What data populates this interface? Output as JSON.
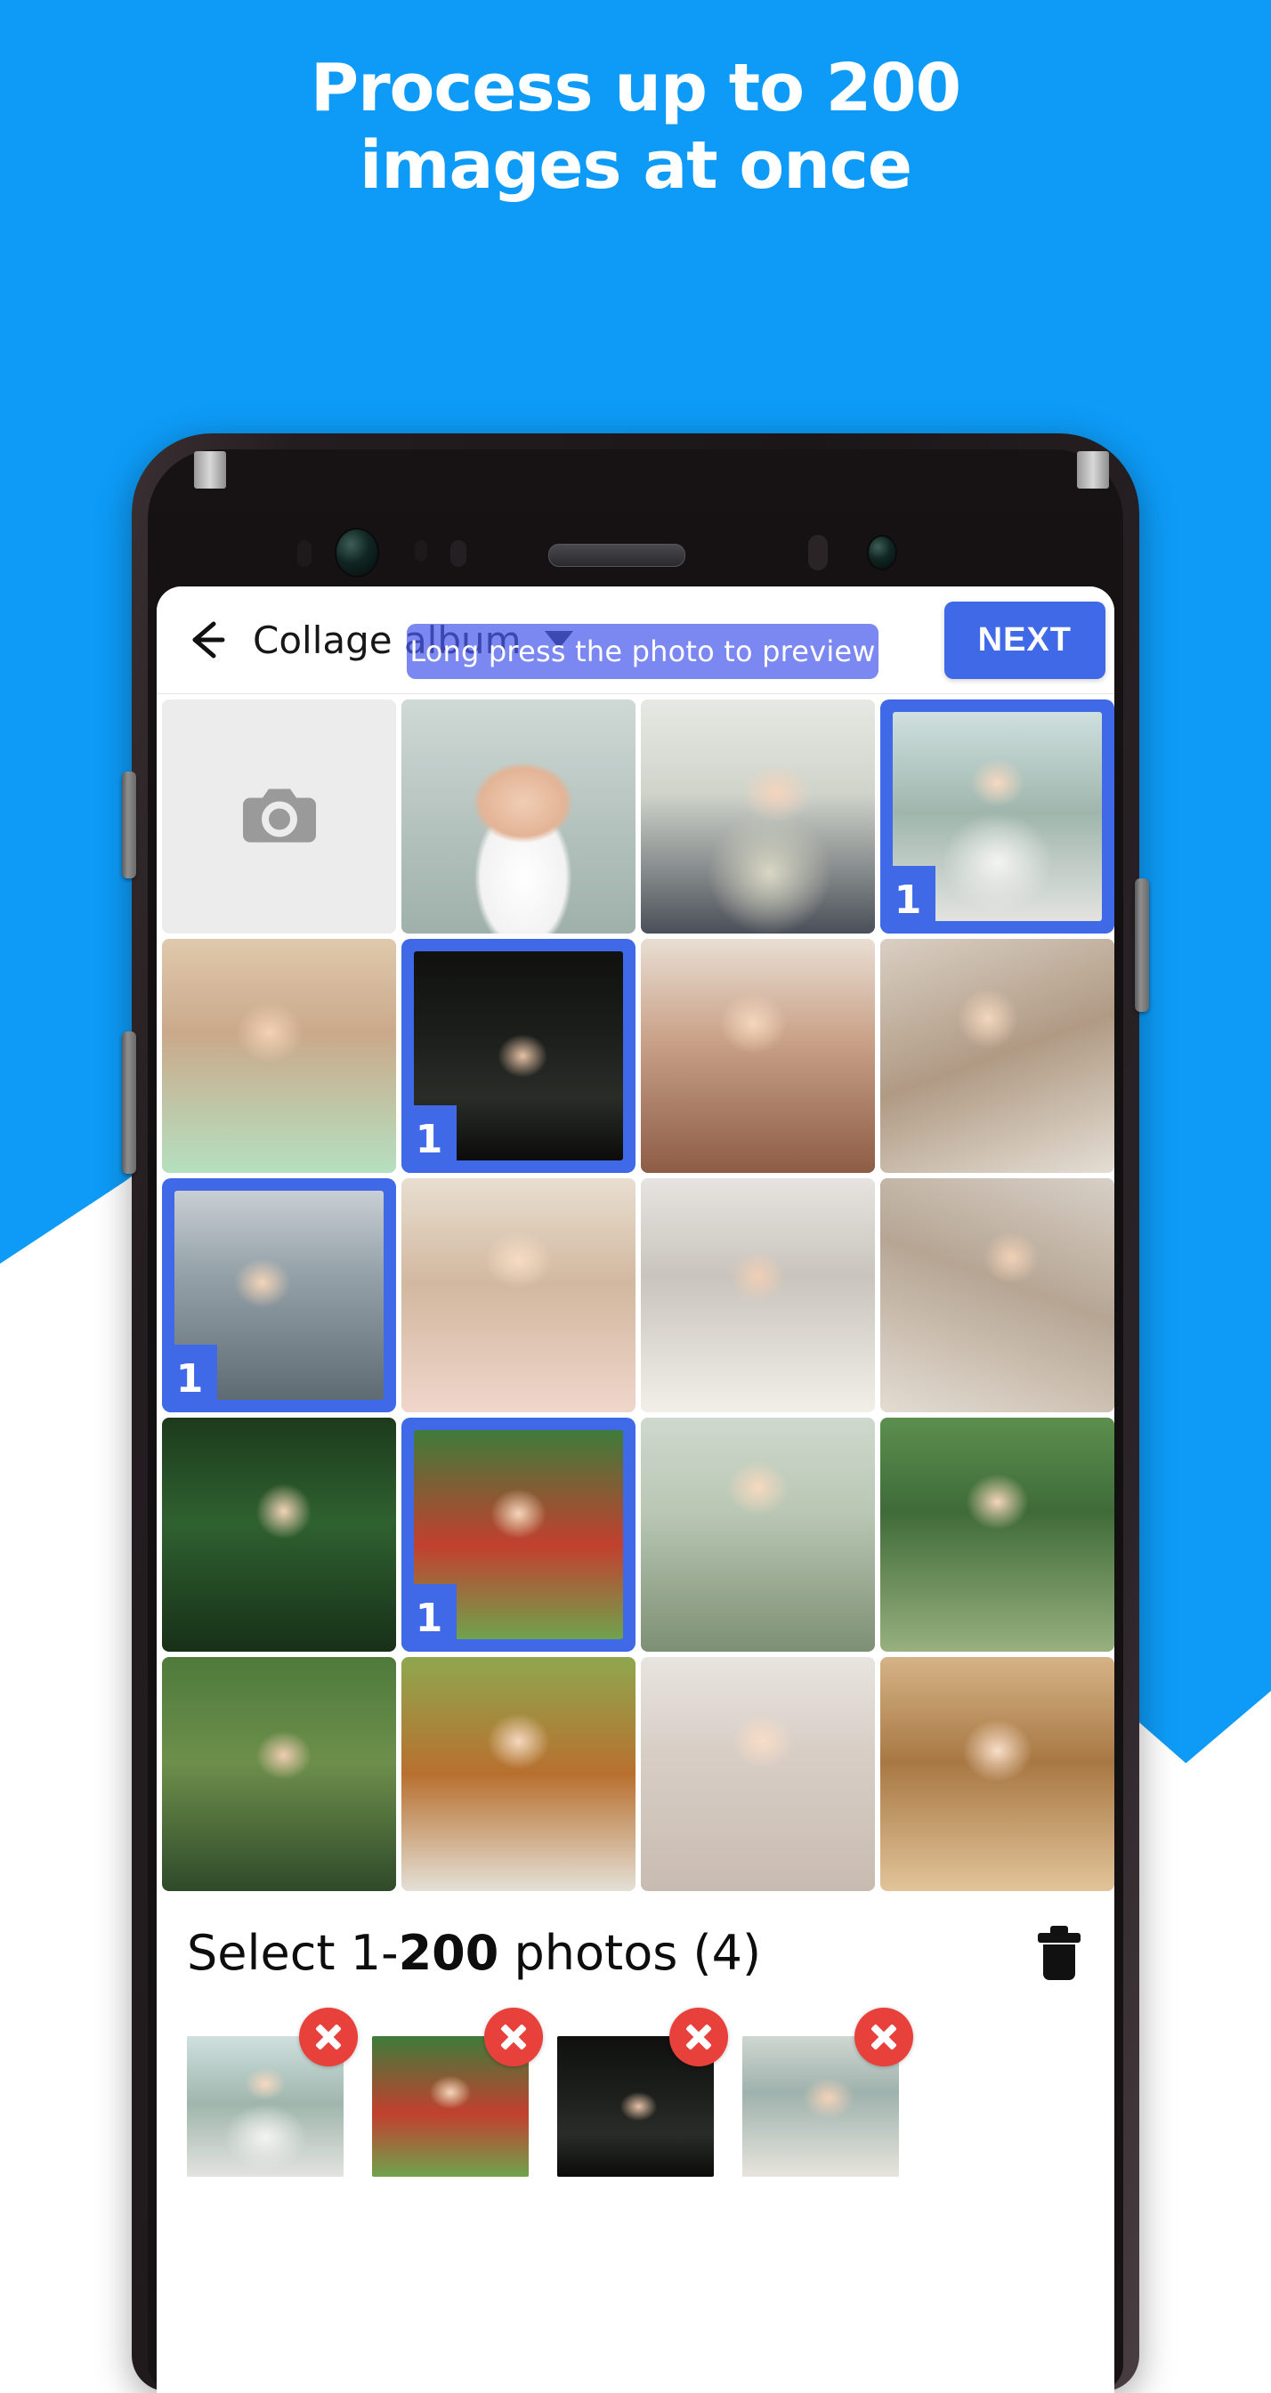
{
  "background": {
    "brand_blue": "#0d9bf7",
    "accent_blue": "#4069e8",
    "remove_red": "#e8413c"
  },
  "headline": {
    "line1": "Process up to 200",
    "line2": "images at once"
  },
  "appbar": {
    "back_icon": "arrow-left-icon",
    "title": "Collage album",
    "dropdown_icon": "chevron-down-icon",
    "next_label": "NEXT"
  },
  "tooltip": {
    "text": "Long press the photo to preview"
  },
  "gallery": {
    "camera_tile": {
      "icon": "camera-icon",
      "label": ""
    },
    "tiles": [
      {
        "art": "p-a",
        "selected": false,
        "badge": ""
      },
      {
        "art": "p-b",
        "selected": false,
        "badge": ""
      },
      {
        "art": "p-c",
        "selected": true,
        "badge": "1"
      },
      {
        "art": "p-d",
        "selected": false,
        "badge": ""
      },
      {
        "art": "p-e",
        "selected": true,
        "badge": "1"
      },
      {
        "art": "p-f",
        "selected": false,
        "badge": ""
      },
      {
        "art": "p-g",
        "selected": false,
        "badge": ""
      },
      {
        "art": "p-h",
        "selected": true,
        "badge": "1"
      },
      {
        "art": "p-i",
        "selected": false,
        "badge": ""
      },
      {
        "art": "p-j",
        "selected": false,
        "badge": ""
      },
      {
        "art": "p-k",
        "selected": false,
        "badge": ""
      },
      {
        "art": "p-l",
        "selected": false,
        "badge": ""
      },
      {
        "art": "p-m",
        "selected": true,
        "badge": "1"
      },
      {
        "art": "p-n",
        "selected": false,
        "badge": ""
      },
      {
        "art": "p-o",
        "selected": false,
        "badge": ""
      },
      {
        "art": "p-p",
        "selected": false,
        "badge": ""
      },
      {
        "art": "p-q",
        "selected": false,
        "badge": ""
      },
      {
        "art": "p-r",
        "selected": false,
        "badge": ""
      },
      {
        "art": "p-s",
        "selected": false,
        "badge": ""
      }
    ]
  },
  "footer": {
    "select_prefix": "Select 1-",
    "select_max": "200",
    "select_suffix": " photos (4)",
    "trash_icon": "trash-icon",
    "selected_thumbnails": [
      {
        "art": "p-c",
        "remove_icon": "close-circle-icon"
      },
      {
        "art": "p-m",
        "remove_icon": "close-circle-icon"
      },
      {
        "art": "p-e",
        "remove_icon": "close-circle-icon"
      },
      {
        "art": "p-h",
        "remove_icon": "close-circle-icon"
      }
    ]
  }
}
